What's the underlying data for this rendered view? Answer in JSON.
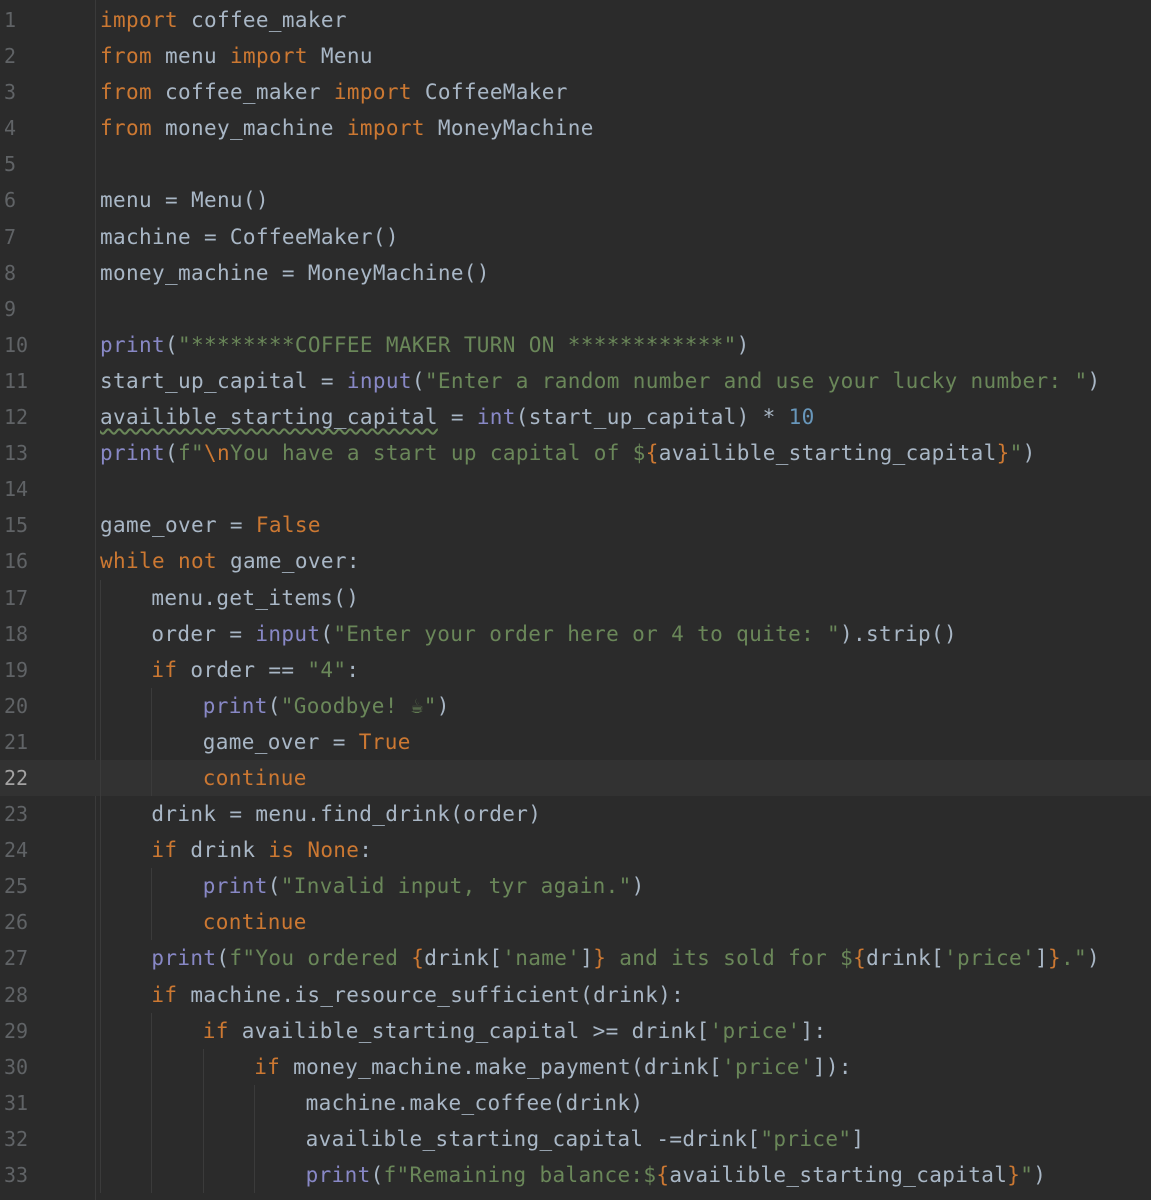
{
  "editor": {
    "colors": {
      "background": "#2b2b2b",
      "current_line": "#323232",
      "gutter_text": "#606366",
      "default": "#a9b7c6",
      "keyword": "#cc7832",
      "string": "#6a8759",
      "builtin": "#8888c6",
      "number": "#6897bb"
    },
    "current_line": 22,
    "lines": [
      {
        "n": "1",
        "indent": 0,
        "tokens": [
          [
            "kw",
            "import"
          ],
          [
            "default",
            " coffee_maker"
          ]
        ]
      },
      {
        "n": "2",
        "indent": 0,
        "tokens": [
          [
            "kw",
            "from"
          ],
          [
            "default",
            " menu "
          ],
          [
            "kw",
            "import"
          ],
          [
            "default",
            " Menu"
          ]
        ]
      },
      {
        "n": "3",
        "indent": 0,
        "tokens": [
          [
            "kw",
            "from"
          ],
          [
            "default",
            " coffee_maker "
          ],
          [
            "kw",
            "import"
          ],
          [
            "default",
            " CoffeeMaker"
          ]
        ]
      },
      {
        "n": "4",
        "indent": 0,
        "tokens": [
          [
            "kw",
            "from"
          ],
          [
            "default",
            " money_machine "
          ],
          [
            "kw",
            "import"
          ],
          [
            "default",
            " MoneyMachine"
          ]
        ]
      },
      {
        "n": "5",
        "indent": 0,
        "tokens": []
      },
      {
        "n": "6",
        "indent": 0,
        "tokens": [
          [
            "default",
            "menu = Menu()"
          ]
        ]
      },
      {
        "n": "7",
        "indent": 0,
        "tokens": [
          [
            "default",
            "machine = CoffeeMaker()"
          ]
        ]
      },
      {
        "n": "8",
        "indent": 0,
        "tokens": [
          [
            "default",
            "money_machine = MoneyMachine()"
          ]
        ]
      },
      {
        "n": "9",
        "indent": 0,
        "tokens": []
      },
      {
        "n": "10",
        "indent": 0,
        "tokens": [
          [
            "builtin",
            "print"
          ],
          [
            "default",
            "("
          ],
          [
            "str",
            "\"********COFFEE MAKER TURN ON ************\""
          ],
          [
            "default",
            ")"
          ]
        ]
      },
      {
        "n": "11",
        "indent": 0,
        "tokens": [
          [
            "default",
            "start_up_capital = "
          ],
          [
            "builtin",
            "input"
          ],
          [
            "default",
            "("
          ],
          [
            "str",
            "\"Enter a random number and use your lucky number: \""
          ],
          [
            "default",
            ")"
          ]
        ]
      },
      {
        "n": "12",
        "indent": 0,
        "tokens": [
          [
            "warn",
            "availible_starting_capital"
          ],
          [
            "default",
            " = "
          ],
          [
            "builtin",
            "int"
          ],
          [
            "default",
            "(start_up_capital) * "
          ],
          [
            "num",
            "10"
          ]
        ]
      },
      {
        "n": "13",
        "indent": 0,
        "tokens": [
          [
            "builtin",
            "print"
          ],
          [
            "default",
            "("
          ],
          [
            "str",
            "f\""
          ],
          [
            "esc",
            "\\n"
          ],
          [
            "str",
            "You have a start up capital of $"
          ],
          [
            "brace",
            "{"
          ],
          [
            "default",
            "availible_starting_capital"
          ],
          [
            "brace",
            "}"
          ],
          [
            "str",
            "\""
          ],
          [
            "default",
            ")"
          ]
        ]
      },
      {
        "n": "14",
        "indent": 0,
        "tokens": []
      },
      {
        "n": "15",
        "indent": 0,
        "tokens": [
          [
            "default",
            "game_over = "
          ],
          [
            "kw",
            "False"
          ]
        ]
      },
      {
        "n": "16",
        "indent": 0,
        "tokens": [
          [
            "kw",
            "while not"
          ],
          [
            "default",
            " game_over:"
          ]
        ]
      },
      {
        "n": "17",
        "indent": 1,
        "tokens": [
          [
            "default",
            "menu.get_items()"
          ]
        ]
      },
      {
        "n": "18",
        "indent": 1,
        "tokens": [
          [
            "default",
            "order = "
          ],
          [
            "builtin",
            "input"
          ],
          [
            "default",
            "("
          ],
          [
            "str",
            "\"Enter your order here or 4 to quite: \""
          ],
          [
            "default",
            ").strip()"
          ]
        ]
      },
      {
        "n": "19",
        "indent": 1,
        "tokens": [
          [
            "kw",
            "if"
          ],
          [
            "default",
            " order == "
          ],
          [
            "str",
            "\"4\""
          ],
          [
            "default",
            ":"
          ]
        ]
      },
      {
        "n": "20",
        "indent": 2,
        "tokens": [
          [
            "builtin",
            "print"
          ],
          [
            "default",
            "("
          ],
          [
            "str",
            "\"Goodbye! ☕\""
          ],
          [
            "default",
            ")"
          ]
        ]
      },
      {
        "n": "21",
        "indent": 2,
        "tokens": [
          [
            "default",
            "game_over = "
          ],
          [
            "kw",
            "True"
          ]
        ]
      },
      {
        "n": "22",
        "indent": 2,
        "tokens": [
          [
            "kw",
            "continue"
          ]
        ]
      },
      {
        "n": "23",
        "indent": 1,
        "tokens": [
          [
            "default",
            "drink = menu.find_drink(order)"
          ]
        ]
      },
      {
        "n": "24",
        "indent": 1,
        "tokens": [
          [
            "kw",
            "if"
          ],
          [
            "default",
            " drink "
          ],
          [
            "kw",
            "is None"
          ],
          [
            "default",
            ":"
          ]
        ]
      },
      {
        "n": "25",
        "indent": 2,
        "tokens": [
          [
            "builtin",
            "print"
          ],
          [
            "default",
            "("
          ],
          [
            "str",
            "\"Invalid input, tyr again.\""
          ],
          [
            "default",
            ")"
          ]
        ]
      },
      {
        "n": "26",
        "indent": 2,
        "tokens": [
          [
            "kw",
            "continue"
          ]
        ]
      },
      {
        "n": "27",
        "indent": 1,
        "tokens": [
          [
            "builtin",
            "print"
          ],
          [
            "default",
            "("
          ],
          [
            "str",
            "f\"You ordered "
          ],
          [
            "brace",
            "{"
          ],
          [
            "default",
            "drink["
          ],
          [
            "str",
            "'name'"
          ],
          [
            "default",
            "]"
          ],
          [
            "brace",
            "}"
          ],
          [
            "str",
            " and its sold for $"
          ],
          [
            "brace",
            "{"
          ],
          [
            "default",
            "drink["
          ],
          [
            "str",
            "'price'"
          ],
          [
            "default",
            "]"
          ],
          [
            "brace",
            "}"
          ],
          [
            "str",
            ".\""
          ],
          [
            "default",
            ")"
          ]
        ]
      },
      {
        "n": "28",
        "indent": 1,
        "tokens": [
          [
            "kw",
            "if"
          ],
          [
            "default",
            " machine.is_resource_sufficient(drink):"
          ]
        ]
      },
      {
        "n": "29",
        "indent": 2,
        "tokens": [
          [
            "kw",
            "if"
          ],
          [
            "default",
            " availible_starting_capital >= drink["
          ],
          [
            "str",
            "'price'"
          ],
          [
            "default",
            "]:"
          ]
        ]
      },
      {
        "n": "30",
        "indent": 3,
        "tokens": [
          [
            "kw",
            "if"
          ],
          [
            "default",
            " money_machine.make_payment(drink["
          ],
          [
            "str",
            "'price'"
          ],
          [
            "default",
            "]):"
          ]
        ]
      },
      {
        "n": "31",
        "indent": 4,
        "tokens": [
          [
            "default",
            "machine.make_coffee(drink)"
          ]
        ]
      },
      {
        "n": "32",
        "indent": 4,
        "tokens": [
          [
            "default",
            "availible_starting_capital -=drink["
          ],
          [
            "str",
            "\"price\""
          ],
          [
            "default",
            "]"
          ]
        ]
      },
      {
        "n": "33",
        "indent": 4,
        "tokens": [
          [
            "builtin",
            "print"
          ],
          [
            "default",
            "("
          ],
          [
            "str",
            "f\"Remaining balance:$"
          ],
          [
            "brace",
            "{"
          ],
          [
            "default",
            "availible_starting_capital"
          ],
          [
            "brace",
            "}"
          ],
          [
            "str",
            "\""
          ],
          [
            "default",
            ")"
          ]
        ]
      }
    ]
  }
}
